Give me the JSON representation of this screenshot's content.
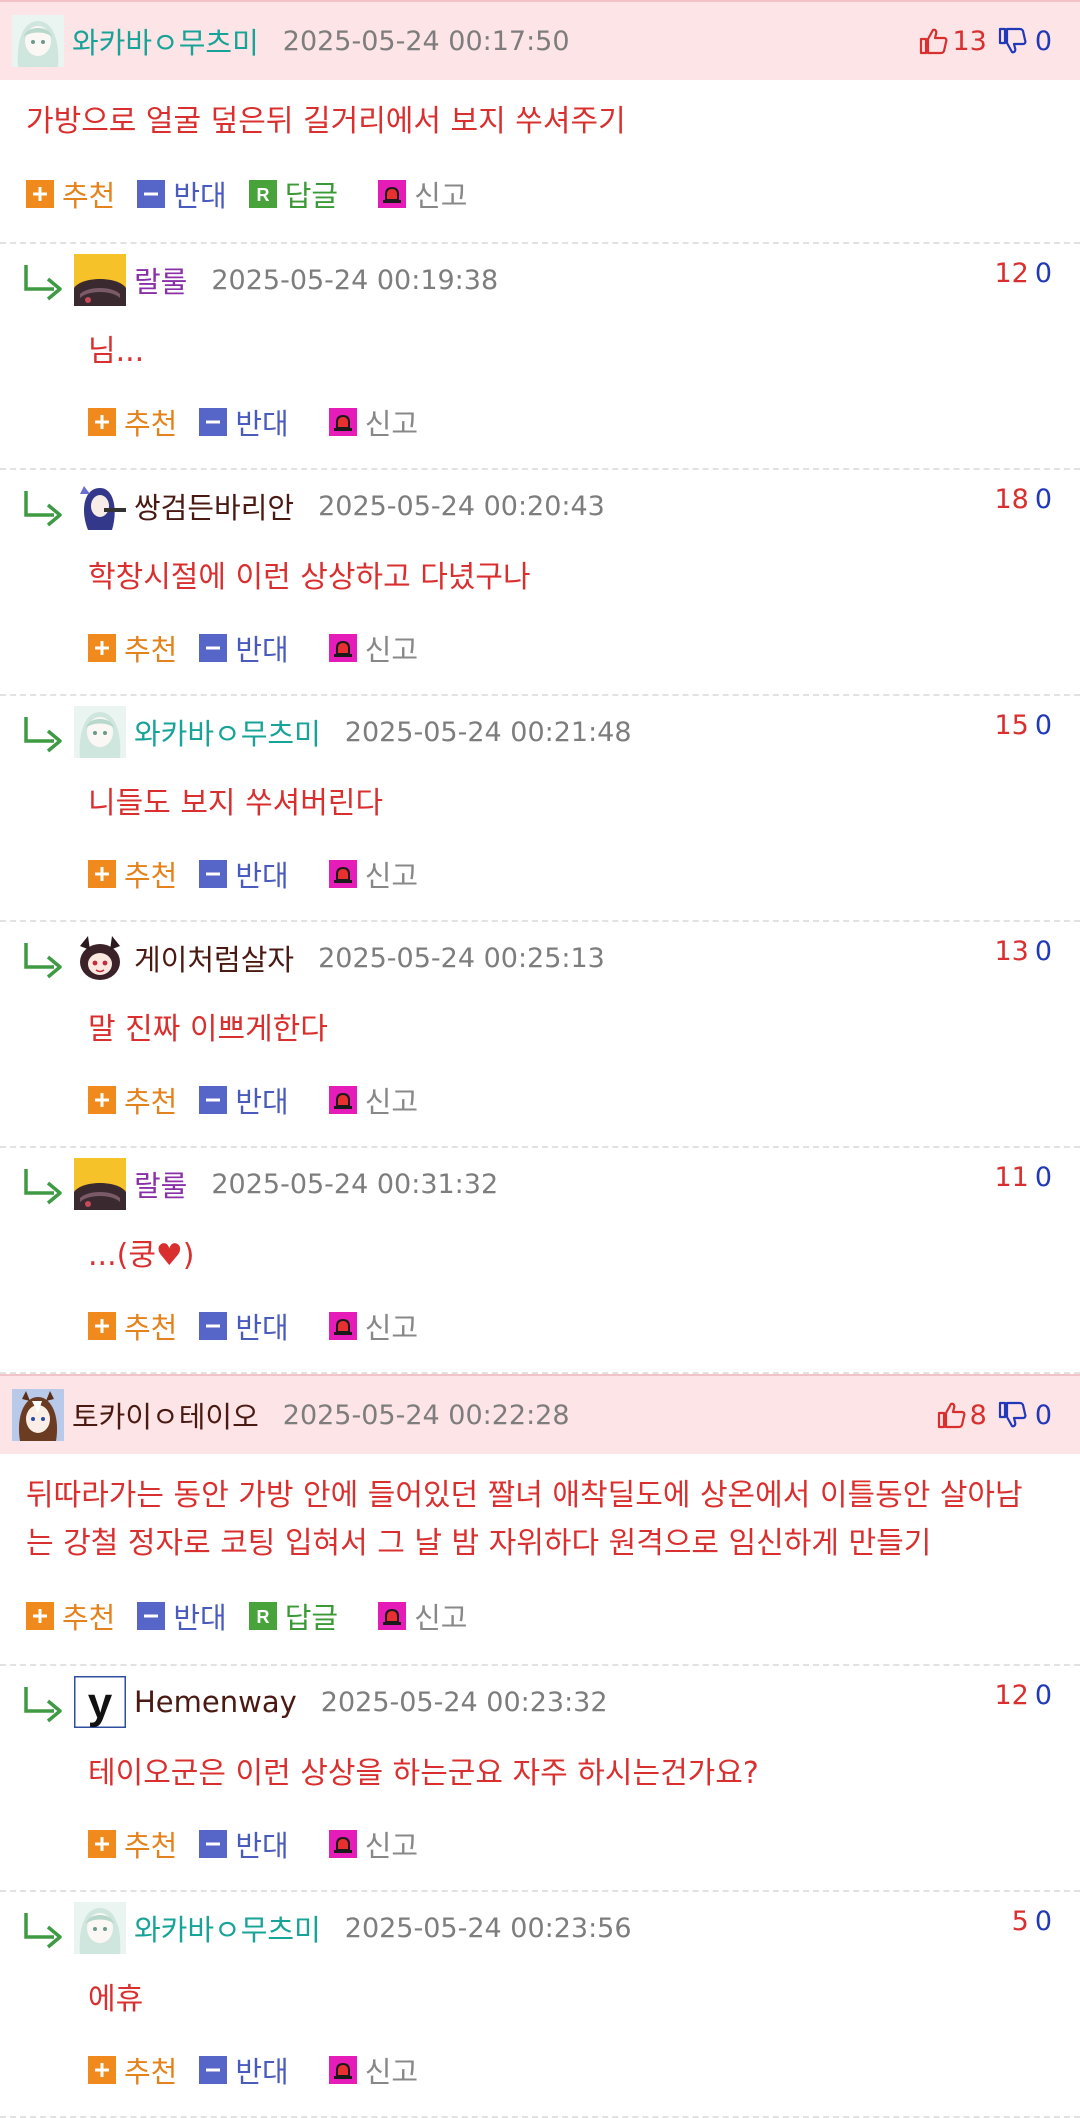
{
  "labels": {
    "recommend": "추천",
    "oppose": "반대",
    "reply": "답글",
    "report": "신고"
  },
  "colors": {
    "top_bg": "#fde4e6",
    "body_text": "#d9302f",
    "recommend": "#e4831c",
    "oppose": "#4a5bc0",
    "reply": "#3b9a36",
    "up": "#d92f2f",
    "down": "#2139b8"
  },
  "comments": [
    {
      "type": "top",
      "nick": "와카바ㅇ무츠미",
      "nick_color": "#17a397",
      "avatar": "avatar-mint-hair",
      "date": "2025-05-24 00:17:50",
      "up": "13",
      "down": "0",
      "body": "가방으로 얼굴 덮은뒤 길거리에서 보지 쑤셔주기"
    },
    {
      "type": "reply",
      "nick": "랄룰",
      "nick_color": "#8a2fa8",
      "avatar": "avatar-yellow-helmet",
      "date": "2025-05-24 00:19:38",
      "up": "12",
      "down": "0",
      "body": "님..."
    },
    {
      "type": "reply",
      "nick": "쌍검든바리안",
      "nick_color": "#4a1a12",
      "avatar": "avatar-blue-hair-gun",
      "date": "2025-05-24 00:20:43",
      "up": "18",
      "down": "0",
      "body": "학창시절에 이런 상상하고 다녔구나"
    },
    {
      "type": "reply",
      "nick": "와카바ㅇ무츠미",
      "nick_color": "#17a397",
      "avatar": "avatar-mint-hair",
      "date": "2025-05-24 00:21:48",
      "up": "15",
      "down": "0",
      "body": "니들도 보지 쑤셔버린다"
    },
    {
      "type": "reply",
      "nick": "게이처럼살자",
      "nick_color": "#4a1a12",
      "avatar": "avatar-dark-red-hair",
      "date": "2025-05-24 00:25:13",
      "up": "13",
      "down": "0",
      "body": "말 진짜 이쁘게한다"
    },
    {
      "type": "reply",
      "nick": "랄룰",
      "nick_color": "#8a2fa8",
      "avatar": "avatar-yellow-helmet",
      "date": "2025-05-24 00:31:32",
      "up": "11",
      "down": "0",
      "body": "...(쿵♥)"
    },
    {
      "type": "top",
      "nick": "토카이ㅇ테이오",
      "nick_color": "#4a1a12",
      "avatar": "avatar-horse-girl",
      "date": "2025-05-24 00:22:28",
      "up": "8",
      "down": "0",
      "body": "뒤따라가는 동안 가방 안에 들어있던 짤녀 애착딜도에 상온에서 이틀동안 살아남는 강철 정자로 코팅 입혀서 그 날 밤 자위하다 원격으로 임신하게 만들기"
    },
    {
      "type": "reply",
      "nick": "Hemenway",
      "nick_color": "#4a1a12",
      "avatar": "avatar-letter-y",
      "date": "2025-05-24 00:23:32",
      "up": "12",
      "down": "0",
      "body": "테이오군은 이런 상상을 하는군요 자주 하시는건가요?"
    },
    {
      "type": "reply",
      "nick": "와카바ㅇ무츠미",
      "nick_color": "#17a397",
      "avatar": "avatar-mint-hair",
      "date": "2025-05-24 00:23:56",
      "up": "5",
      "down": "0",
      "body": "에휴"
    }
  ]
}
